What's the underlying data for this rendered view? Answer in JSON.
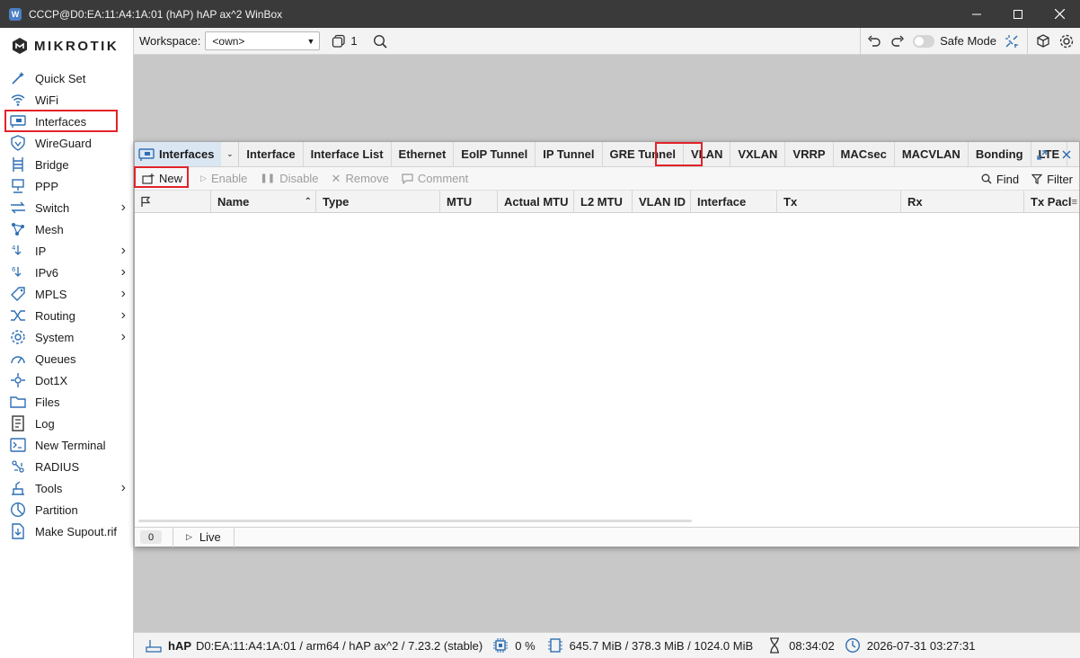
{
  "window": {
    "title": "CCCP@D0:EA:11:A4:1A:01 (hAP) hAP ax^2 WinBox",
    "controls": [
      "minimize",
      "maximize",
      "close"
    ]
  },
  "brand": {
    "logo_text": "MIKROTIK"
  },
  "sidebar": {
    "items": [
      {
        "label": "Quick Set",
        "icon": "quickset-wand-icon",
        "submenu": false
      },
      {
        "label": "WiFi",
        "icon": "wifi-icon",
        "submenu": false
      },
      {
        "label": "Interfaces",
        "icon": "interfaces-icon",
        "submenu": false,
        "highlighted": true
      },
      {
        "label": "WireGuard",
        "icon": "wireguard-shield-icon",
        "submenu": false
      },
      {
        "label": "Bridge",
        "icon": "bridge-icon",
        "submenu": false
      },
      {
        "label": "PPP",
        "icon": "ppp-icon",
        "submenu": false
      },
      {
        "label": "Switch",
        "icon": "switch-icon",
        "submenu": true
      },
      {
        "label": "Mesh",
        "icon": "mesh-icon",
        "submenu": false
      },
      {
        "label": "IP",
        "icon": "ip-icon",
        "submenu": true
      },
      {
        "label": "IPv6",
        "icon": "ipv6-icon",
        "submenu": true
      },
      {
        "label": "MPLS",
        "icon": "mpls-tag-icon",
        "submenu": true
      },
      {
        "label": "Routing",
        "icon": "routing-icon",
        "submenu": true
      },
      {
        "label": "System",
        "icon": "system-gear-icon",
        "submenu": true
      },
      {
        "label": "Queues",
        "icon": "queues-gauge-icon",
        "submenu": false
      },
      {
        "label": "Dot1X",
        "icon": "dot1x-icon",
        "submenu": false
      },
      {
        "label": "Files",
        "icon": "files-folder-icon",
        "submenu": false
      },
      {
        "label": "Log",
        "icon": "log-icon",
        "submenu": false
      },
      {
        "label": "New Terminal",
        "icon": "terminal-icon",
        "submenu": false
      },
      {
        "label": "RADIUS",
        "icon": "radius-icon",
        "submenu": false
      },
      {
        "label": "Tools",
        "icon": "tools-icon",
        "submenu": true
      },
      {
        "label": "Partition",
        "icon": "partition-icon",
        "submenu": false
      },
      {
        "label": "Make Supout.rif",
        "icon": "supout-icon",
        "submenu": false
      }
    ]
  },
  "toolbar": {
    "workspace_label": "Workspace:",
    "workspace_value": "<own>",
    "window_count": "1",
    "safe_mode_label": "Safe Mode",
    "safe_mode_on": false
  },
  "interfaces_window": {
    "title": "Interfaces",
    "tabs": [
      "Interface",
      "Interface List",
      "Ethernet",
      "EoIP Tunnel",
      "IP Tunnel",
      "GRE Tunnel",
      "VLAN",
      "VXLAN",
      "VRRP",
      "MACsec",
      "MACVLAN",
      "Bonding",
      "LTE"
    ],
    "highlighted_tab": "VLAN",
    "actions": {
      "new": "New",
      "enable": "Enable",
      "disable": "Disable",
      "remove": "Remove",
      "comment": "Comment",
      "find": "Find",
      "filter": "Filter"
    },
    "columns": [
      "",
      "Name",
      "Type",
      "MTU",
      "Actual MTU",
      "L2 MTU",
      "VLAN ID",
      "Interface",
      "Tx",
      "Rx",
      "Tx Pacl"
    ],
    "row_count": "0",
    "live_label": "Live"
  },
  "statusbar": {
    "device": "hAP",
    "details": "D0:EA:11:A4:1A:01 / arm64 / hAP ax^2 / 7.23.2 (stable)",
    "cpu": "0 %",
    "memory": "645.7 MiB / 378.3 MiB / 1024.0 MiB",
    "uptime": "08:34:02",
    "datetime": "2026-07-31 03:27:31"
  },
  "colors": {
    "highlight_red": "#e2232a",
    "titlebar": "#3a3a3a",
    "workspace_gray": "#c8c8c8",
    "accent_blue": "#2f6fb3"
  }
}
